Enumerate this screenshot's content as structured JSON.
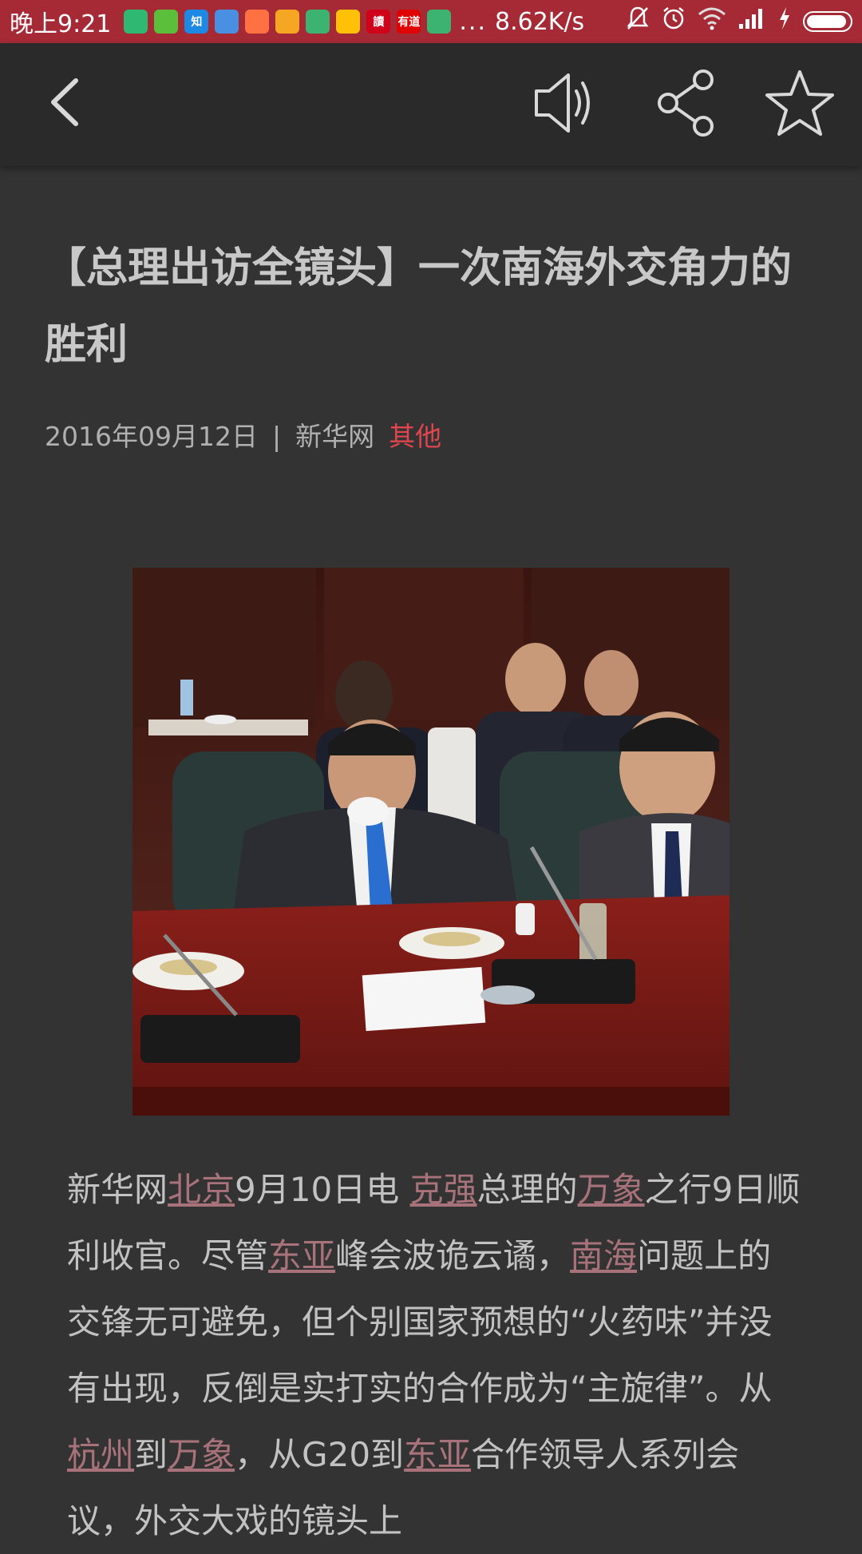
{
  "status_bar": {
    "time": "晚上9:21",
    "network_speed": "8.62K/s",
    "more": "...",
    "notification_icons": [
      {
        "name": "shield-app-icon",
        "label": "",
        "color": "#2eb872"
      },
      {
        "name": "battery-app-icon",
        "label": "",
        "color": "#5cbf3b"
      },
      {
        "name": "zhihu-app-icon",
        "label": "知",
        "color": "#1e88e5"
      },
      {
        "name": "app-icon",
        "label": "",
        "color": "#4a90e2"
      },
      {
        "name": "shopping-bag-icon",
        "label": "",
        "color": "#ff7043"
      },
      {
        "name": "mail-icon",
        "label": "",
        "color": "#f5a623"
      },
      {
        "name": "play-icon",
        "label": "",
        "color": "#3cb371"
      },
      {
        "name": "video-app-icon",
        "label": "",
        "color": "#ffc107"
      },
      {
        "name": "reading-app-icon",
        "label": "讀",
        "color": "#d0021b"
      },
      {
        "name": "youdao-app-icon",
        "label": "有道",
        "color": "#e00000"
      },
      {
        "name": "play-icon-2",
        "label": "",
        "color": "#3cb371"
      }
    ],
    "battery_level": 0.95
  },
  "toolbar": {
    "back_icon": "chevron-left-icon",
    "sound_icon": "speaker-icon",
    "share_icon": "share-icon",
    "favorite_icon": "star-icon"
  },
  "article": {
    "title": "【总理出访全镜头】一次南海外交角力的胜利",
    "date": "2016年09月12日",
    "separator": "|",
    "source": "新华网",
    "category": "其他",
    "category_color": "#e0454e",
    "photo_alt": "",
    "paragraph": [
      {
        "text": "新华网",
        "link": false
      },
      {
        "text": "北京",
        "link": true
      },
      {
        "text": "9月10日电 ",
        "link": false
      },
      {
        "text": "克强",
        "link": true
      },
      {
        "text": "总理的",
        "link": false
      },
      {
        "text": "万象",
        "link": true
      },
      {
        "text": "之行9日顺利收官。尽管",
        "link": false
      },
      {
        "text": "东亚",
        "link": true
      },
      {
        "text": "峰会波诡云谲，",
        "link": false
      },
      {
        "text": "南海",
        "link": true
      },
      {
        "text": "问题上的交锋无可避免，但个别国家预想的“火药味”并没有出现，反倒是实打实的合作成为“主旋律”。从",
        "link": false
      },
      {
        "text": "杭州",
        "link": true
      },
      {
        "text": "到",
        "link": false
      },
      {
        "text": "万象",
        "link": true
      },
      {
        "text": "，从G20到",
        "link": false
      },
      {
        "text": "东亚",
        "link": true
      },
      {
        "text": "合作领导人系列会议，外交大戏的镜头上",
        "link": false
      }
    ]
  }
}
